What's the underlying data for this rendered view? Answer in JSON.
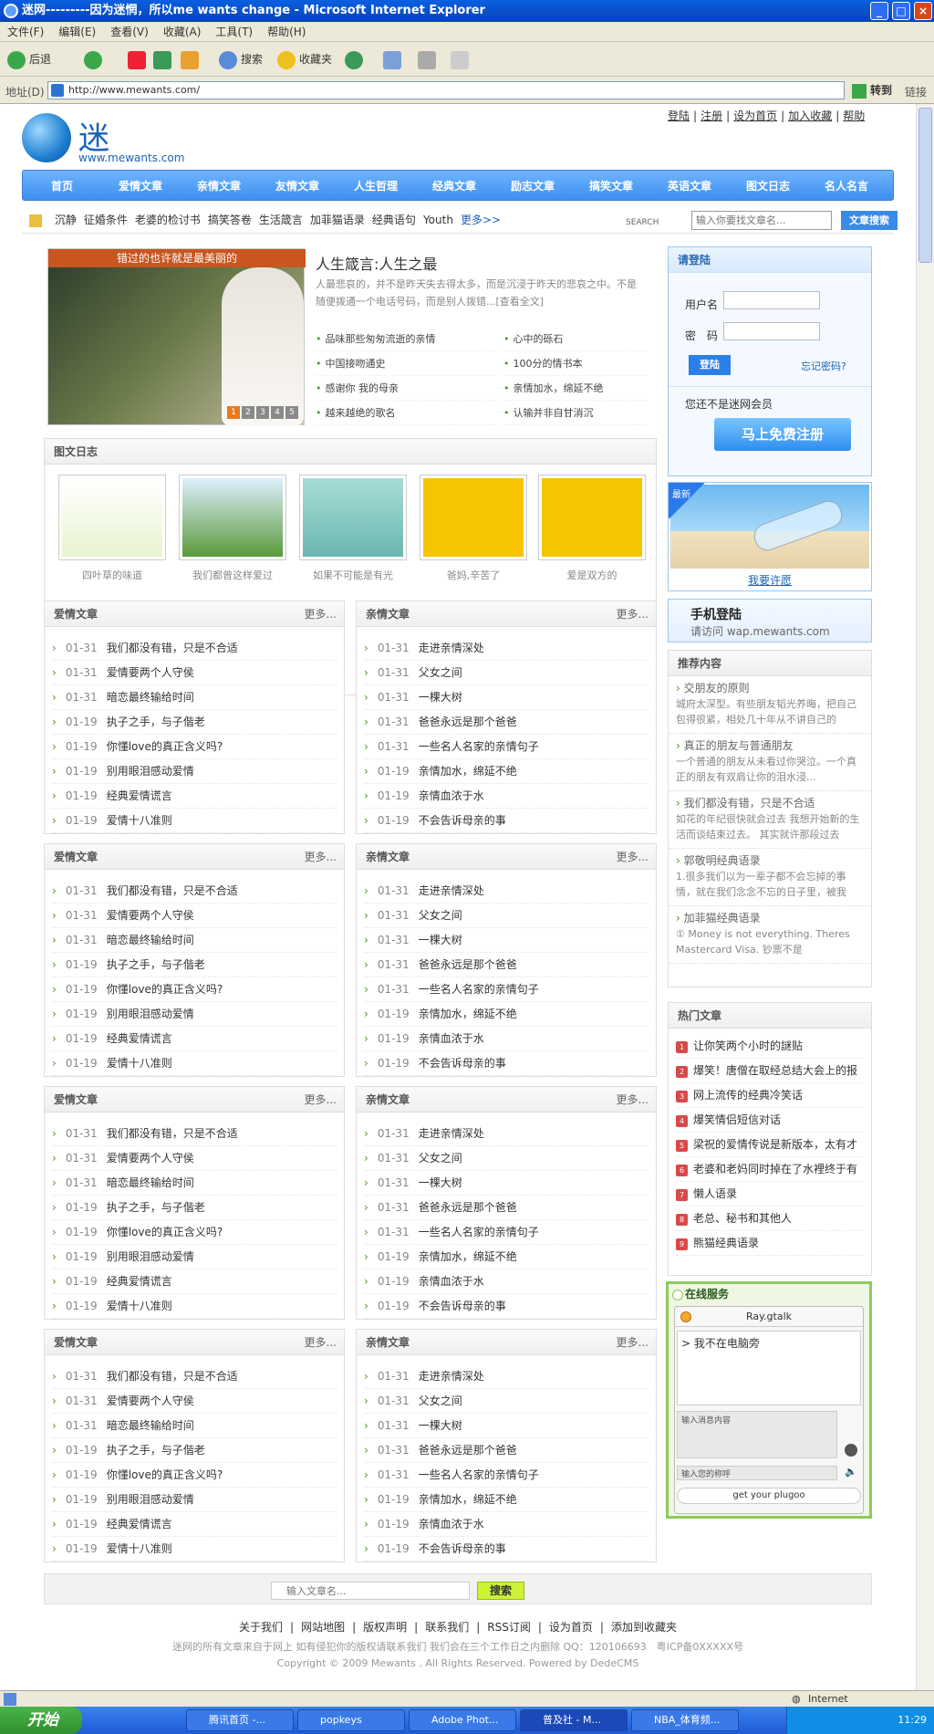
{
  "window": {
    "title": "迷网---------因为迷惘，所以me wants change - Microsoft Internet Explorer",
    "min": "_",
    "max": "□",
    "close": "×"
  },
  "menu": [
    "文件(F)",
    "编辑(E)",
    "查看(V)",
    "收藏(A)",
    "工具(T)",
    "帮助(H)"
  ],
  "toolbar": {
    "back": "后退",
    "search": "搜索",
    "favorites": "收藏夹"
  },
  "address": {
    "label": "地址(D)",
    "url": "http://www.mewants.com/",
    "go": "转到",
    "links": "链接"
  },
  "site": {
    "logo_text": "迷",
    "logo_url": "www.mewants.com",
    "toplinks": [
      "登陆",
      "注册",
      "设为首页",
      "加入收藏",
      "帮助"
    ],
    "nav": [
      "首页",
      "爱情文章",
      "亲情文章",
      "友情文章",
      "人生哲理",
      "经典文章",
      "励志文章",
      "搞笑文章",
      "英语文章",
      "图文日志",
      "名人名言"
    ],
    "keywords": [
      "沉静",
      "征婚条件",
      "老婆的检讨书",
      "搞笑答卷",
      "生活箴言",
      "加菲猫语录",
      "经典语句",
      "Youth"
    ],
    "keywords_more": "更多>>",
    "search": {
      "label": "SEARCH",
      "placeholder": "输入你要找文章名...",
      "button": "文章搜索"
    }
  },
  "feature": {
    "caption": "错过的也许就是最美丽的",
    "pages": [
      "1",
      "2",
      "3",
      "4",
      "5"
    ],
    "title": "人生箴言:人生之最",
    "desc": "人最悲哀的，并不是昨天失去得太多，而是沉浸于昨天的悲哀之中。不是随便拨通一个电话号码，而是别人拨错...[查看全文]",
    "left": [
      "品味那些匆匆流逝的亲情",
      "中国接吻通史",
      "感谢你 我的母亲",
      "越来越绝的歌名"
    ],
    "right": [
      "心中的砾石",
      "100分的情书本",
      "亲情加水，绵延不绝",
      "认输并非自甘消沉"
    ]
  },
  "photolog": {
    "title": "图文日志",
    "items": [
      "四叶草的味道",
      "我们都曾这样爱过",
      "如果不可能是有光",
      "爸妈,辛苦了",
      "爱是双方的"
    ]
  },
  "sections": [
    {
      "left": {
        "title": "爱情文章",
        "more": "更多...",
        "items": [
          [
            "01-31",
            "我们都没有错，只是不合适"
          ],
          [
            "01-31",
            "爱情要两个人守侯"
          ],
          [
            "01-31",
            "暗恋最终输给时间"
          ],
          [
            "01-19",
            "执子之手，与子偕老"
          ],
          [
            "01-19",
            "你懂love的真正含义吗?"
          ],
          [
            "01-19",
            "别用眼泪感动爱情"
          ],
          [
            "01-19",
            "经典爱情谎言"
          ],
          [
            "01-19",
            "爱情十八准则"
          ]
        ]
      },
      "right": {
        "title": "亲情文章",
        "more": "更多...",
        "items": [
          [
            "01-31",
            "走进亲情深处"
          ],
          [
            "01-31",
            "父女之间"
          ],
          [
            "01-31",
            "一棵大树"
          ],
          [
            "01-31",
            "爸爸永远是那个爸爸"
          ],
          [
            "01-31",
            "一些名人名家的亲情句子"
          ],
          [
            "01-19",
            "亲情加水，绵延不绝"
          ],
          [
            "01-19",
            "亲情血浓于水"
          ],
          [
            "01-19",
            "不会告诉母亲的事"
          ]
        ]
      }
    }
  ],
  "login": {
    "title": "请登陆",
    "user": "用户名",
    "pass": "密　码",
    "button": "登陆",
    "forgot": "忘记密码?",
    "notmember": "您还不是迷网会员",
    "register": "马上免费注册"
  },
  "bottle": {
    "tag": "最新",
    "caption": "我要许愿"
  },
  "mobile": {
    "title": "手机登陆",
    "sub": "请访问 wap.mewants.com"
  },
  "recommend": {
    "title": "推荐内容",
    "items": [
      {
        "t": "交朋友的原则",
        "s": "城府太深型。有些朋友韬光养晦，把自己包得很紧，相处几十年从不讲自己的"
      },
      {
        "t": "真正的朋友与普通朋友",
        "s": "一个普通的朋友从未看过你哭泣。一个真正的朋友有双肩让你的泪水浸..."
      },
      {
        "t": "我们都没有错，只是不合适",
        "s": "如花的年纪很快就会过去 我想开始新的生活而谈结束过去。 其实就许那段过去"
      },
      {
        "t": "郭敬明经典语录",
        "s": "1.很多我们以为一辈子都不会忘掉的事情，就在我们念念不忘的日子里，被我"
      },
      {
        "t": "加菲猫经典语录",
        "s": "① Money is not everything. Theres Mastercard Visa. 钞票不是"
      }
    ]
  },
  "hot": {
    "title": "热门文章",
    "items": [
      "让你笑两个小时的謎贴",
      "爆笑！唐僧在取经总结大会上的报",
      "网上流传的经典冷笑话",
      "爆笑情侣短信对话",
      "梁祝的爱情传说是新版本，太有才",
      "老婆和老妈同时掉在了水裡终于有",
      "懒人语录",
      "老总、秘书和其他人",
      "熊猫经典语录"
    ]
  },
  "chat": {
    "title": "在线服务",
    "name": "Ray.gtalk",
    "msg": "> 我不在电脑旁",
    "input": "输入消息内容",
    "nick": "输入您的称呼",
    "get": "get your plugoo"
  },
  "footer": {
    "placeholder": "输入文章名...",
    "search": "搜索",
    "links": [
      "关于我们",
      "网站地图",
      "版权声明",
      "联系我们",
      "RSS订阅",
      "设为首页",
      "添加到收藏夹"
    ],
    "line1": "迷网的所有文章来自于网上 如有侵犯你的版权请联系我们 我们会在三个工作日之内删除 QQ：120106693　粤ICP备0XXXXX号",
    "line2": "Copyright © 2009 Mewants . All Rights Reserved. Powered by DedeCMS"
  },
  "status": {
    "zone": "Internet"
  },
  "taskbar": {
    "start": "开始",
    "tasks": [
      "腾讯首页 -...",
      "popkeys",
      "Adobe Phot...",
      "普及社 - M...",
      "NBA_体育频..."
    ],
    "clock": "11:29"
  }
}
